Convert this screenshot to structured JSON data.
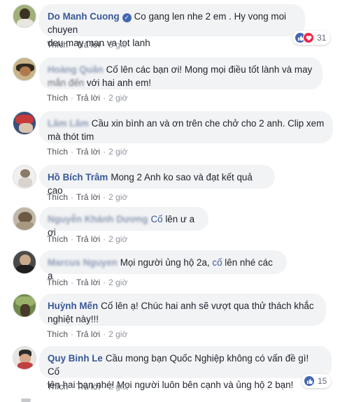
{
  "labels": {
    "like": "Thích",
    "reply": "Trả lời",
    "sep": "·"
  },
  "comments": [
    {
      "author": "Do Manh Cuong",
      "verified": true,
      "line1": "Co gang len nhe 2 em . Hy vong moi chuyen",
      "line2": "deu may man va tot lanh",
      "time": "3 giờ",
      "reactions": {
        "icons": [
          "like-icon",
          "love-icon"
        ],
        "count": "31"
      }
    },
    {
      "author": "Hoàng Quân",
      "line1": "Cố lên các bạn ơi! Mong mọi điều tốt lành và may",
      "line2_blur": "mắn đến",
      "line2": "với hai anh em!",
      "time": "2 giờ"
    },
    {
      "author": "Lâm Lâm",
      "line1": "Cầu xin bình an và ơn trên che chở cho 2 anh. Clip xem",
      "line2": "mà thót tim",
      "time": "2 giờ"
    },
    {
      "author": "Hồ Bích Trâm",
      "line1": "Mong 2 Anh ko sao và đạt kết quả cao",
      "time": "2 giờ"
    },
    {
      "author": "Nguyễn Khánh Dương",
      "tag": "Cố",
      "line1": "lên ư a ơi",
      "time": "2 giờ"
    },
    {
      "author": "Marcus Nguyen",
      "line1a": "Mọi người ủng hộ 2a,",
      "tag": "cố",
      "line1b": "lên nhé các a",
      "time": "2 giờ"
    },
    {
      "author": "Huỳnh Mến",
      "line1": "Cố lên ạ! Chúc hai anh sẽ vượt qua thử thách khắc",
      "line2": "nghiệt này!!!",
      "time": "2 giờ"
    },
    {
      "author": "Quy Binh Le",
      "line1": "Cầu mong bạn Quốc Nghiệp không có vấn đề gì! Cố",
      "line2": "lên hai bạn nhé! Mọi người luôn bên cạnh và ủng hộ 2 bạn!",
      "time": "2 giờ",
      "reactions": {
        "icons": [
          "like-icon"
        ],
        "count": "15"
      }
    }
  ],
  "colors": {
    "author": "#385898",
    "bubble": "#f2f3f5",
    "meta": "#90949c",
    "like": "#4267b2",
    "love": "#f0284a"
  }
}
